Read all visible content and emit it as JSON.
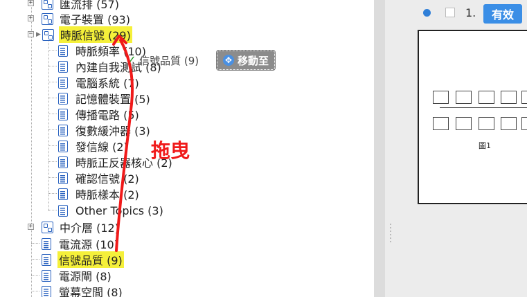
{
  "tree": {
    "nodes": [
      {
        "label": "匯流排 (57)",
        "type": "folder"
      },
      {
        "label": "電子裝置 (93)",
        "type": "folder"
      },
      {
        "label": "時脈信號 (29)",
        "type": "folder"
      },
      {
        "label": "時脈頻率 (10)",
        "type": "doc"
      },
      {
        "label": "內建自我測試 (8)",
        "type": "doc"
      },
      {
        "label": "電腦系統 (7)",
        "type": "doc"
      },
      {
        "label": "記憶體裝置 (5)",
        "type": "doc"
      },
      {
        "label": "傳播電路 (5)",
        "type": "doc"
      },
      {
        "label": "復數緩沖器 (3)",
        "type": "doc"
      },
      {
        "label": "發信線 (2)",
        "type": "doc"
      },
      {
        "label": "時脈正反器核心 (2)",
        "type": "doc"
      },
      {
        "label": "確認信號 (2)",
        "type": "doc"
      },
      {
        "label": "時脈樣本 (2)",
        "type": "doc"
      },
      {
        "label": "Other Topics (3)",
        "type": "doc"
      },
      {
        "label": "中介層 (12)",
        "type": "folder"
      },
      {
        "label": "電流源 (10)",
        "type": "doc"
      },
      {
        "label": "信號品質 (9)",
        "type": "doc"
      },
      {
        "label": "電源閘 (8)",
        "type": "doc"
      },
      {
        "label": "螢幕空間 (8)",
        "type": "doc"
      }
    ]
  },
  "drag": {
    "ghost_label": "信號品質 (9)",
    "move_button_label": "移動至",
    "caption": "拖曳",
    "arrow_color": "#f01a1a",
    "highlight_color": "#f5f03a"
  },
  "right_panel": {
    "item_number": "1.",
    "status_badge": "有效",
    "figure_caption": "圖1",
    "accent": "#3a8ee6"
  }
}
